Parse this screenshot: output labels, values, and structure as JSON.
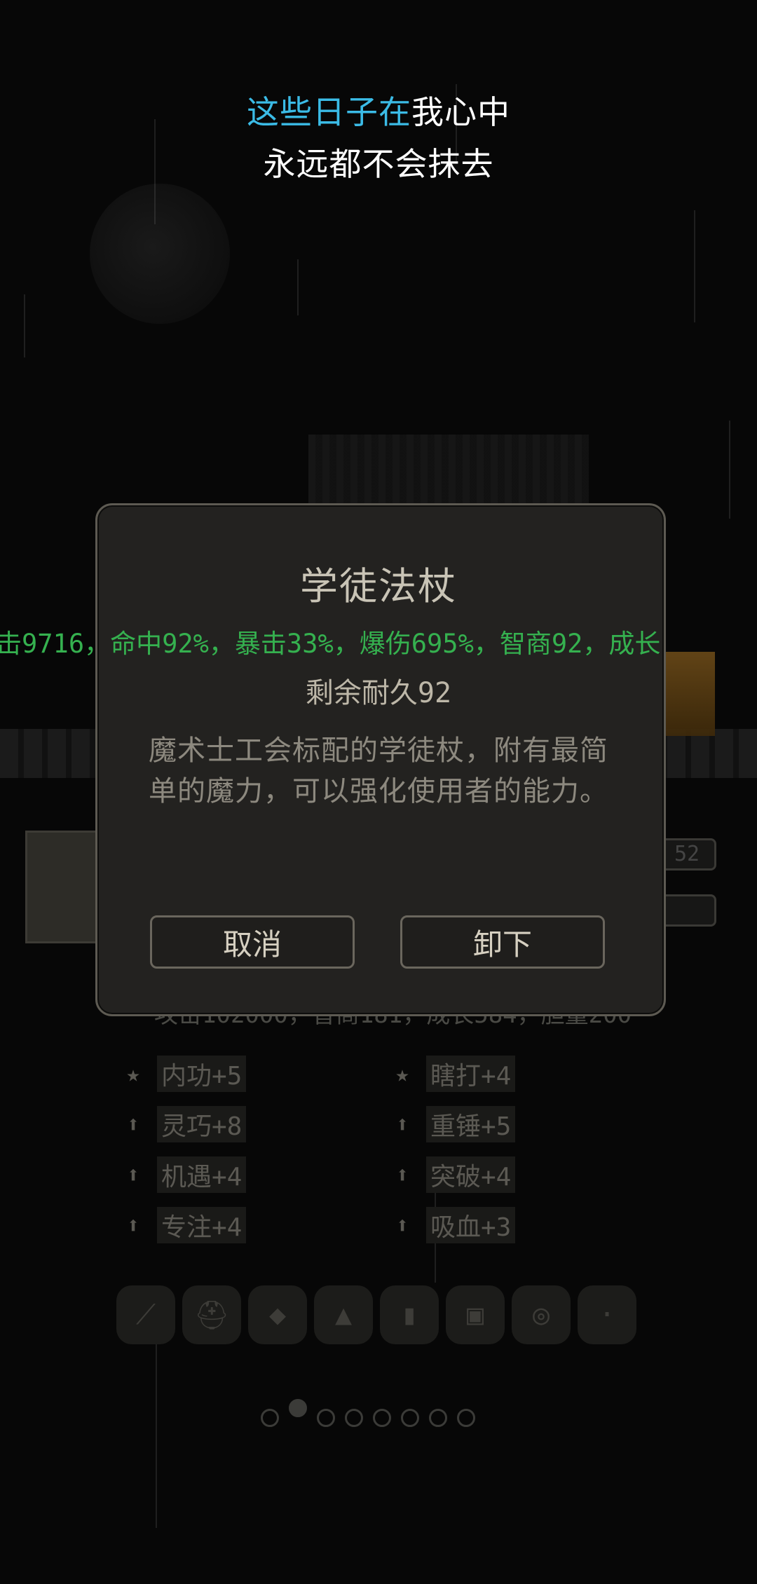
{
  "subtitle": {
    "line1_highlight": "这些日子在",
    "line1_rest": "我心中",
    "line2": "永远都不会抹去"
  },
  "colors": {
    "subtitle_highlight": "#3bbbe6",
    "ticker_green": "#35b14f",
    "dialog_bg": "#232220",
    "dialog_border": "#5d5a52"
  },
  "dialog": {
    "title": "学徒法杖",
    "stats_ticker": "击9716，命中92%，暴击33%，爆伤695%，智商92，成长",
    "durability": "剩余耐久92",
    "description": "魔术士工会标配的学徒杖，附有最简单的魔力，可以强化使用者的能力。",
    "cancel_label": "取消",
    "unequip_label": "卸下"
  },
  "background": {
    "bar1_value": "52",
    "statline": "攻击102000，智商181，成长584，胆量200",
    "skills": [
      {
        "icon": "star-icon",
        "label": "内功+5"
      },
      {
        "icon": "star-icon",
        "label": "瞎打+4"
      },
      {
        "icon": "arrow-up-icon",
        "label": "灵巧+8"
      },
      {
        "icon": "arrow-up-icon",
        "label": "重锤+5"
      },
      {
        "icon": "arrow-up-icon",
        "label": "机遇+4"
      },
      {
        "icon": "arrow-up-icon",
        "label": "突破+4"
      },
      {
        "icon": "arrow-up-icon",
        "label": "专注+4"
      },
      {
        "icon": "arrow-up-icon",
        "label": "吸血+3"
      }
    ],
    "equipment_slots": [
      "staff-icon",
      "helmet-icon",
      "armor-icon",
      "boots-icon",
      "bracer-icon",
      "cloak-icon",
      "ring-icon",
      "empty-slot-icon"
    ],
    "page_count": 8,
    "active_page": 2
  }
}
